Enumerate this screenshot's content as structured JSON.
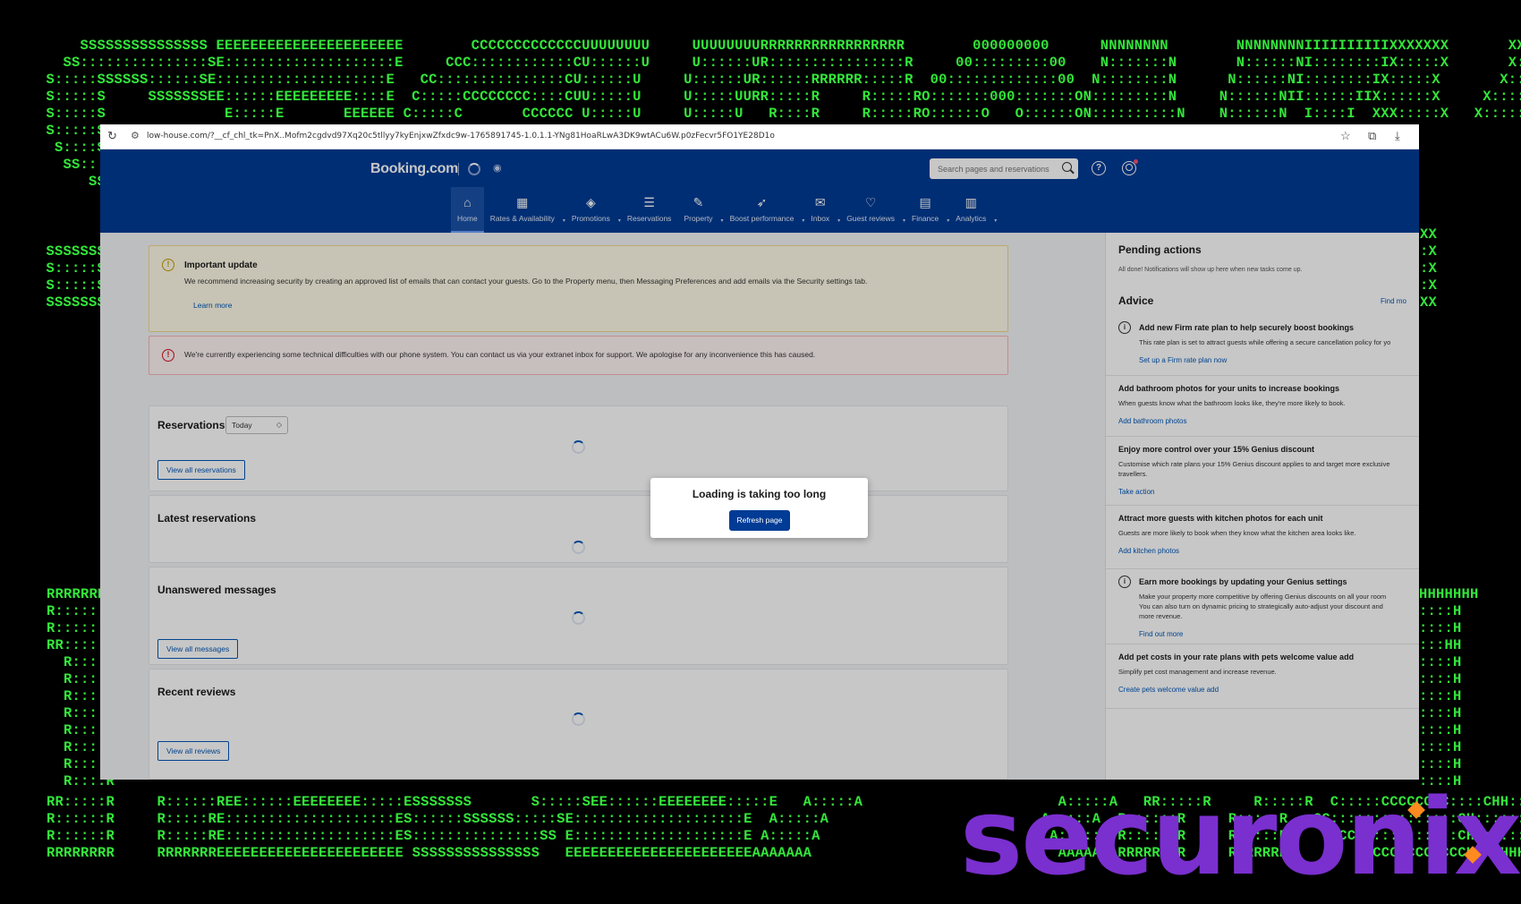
{
  "ascii_art": {
    "top_lines": [
      "     SSSSSSSSSSSSSSS EEEEEEEEEEEEEEEEEEEEEE        CCCCCCCCCCCCCUUUUUUUU     UUUUUUUURRRRRRRRRRRRRRRRR        000000000      NNNNNNNN        NNNNNNNNIIIIIIIIIIXXXXXXX       XXXXXXX",
      "   SS:::::::::::::::SE::::::::::::::::::::E     CCC::::::::::::CU::::::U     U::::::UR::::::::::::::::R     00:::::::::00    N:::::::N       N::::::NI::::::::IX:::::X       X:::::X",
      " S:::::SSSSSS::::::SE::::::::::::::::::::E   CC:::::::::::::::CU::::::U     U::::::UR::::::RRRRRR:::::R  00:::::::::::::00  N::::::::N      N::::::NI::::::::IX:::::X       X:::::X",
      " S:::::S     SSSSSSSEE::::::EEEEEEEEE::::E  C:::::CCCCCCCC::::CUU:::::U     U:::::UURR:::::R     R:::::RO:::::::000:::::::ON:::::::::N     N::::::NII::::::IIX::::::X     X::::::X",
      " S:::::S              E:::::E       EEEEEE C:::::C       CCCCCC U:::::U     U:::::U   R::::R     R:::::RO::::::O   O::::::ON::::::::::N    N::::::N  I::::I  XXX:::::X   X:::::XXX",
      " S:::::S",
      "  S::::SSSS",
      "   SS::::::SSSSS",
      "      SSS::::::::SS"
    ],
    "left_mid_lines": [
      " SSSSSSS",
      " S:::::S",
      " S:::::S",
      " SSSSSSS"
    ],
    "right_mid_lines": [
      "XX",
      ":X",
      ":X",
      ":X",
      "XX"
    ],
    "left_bottom_lines": [
      "RRRRRRRR",
      "R::::::R",
      "R::::::R",
      "RR:::::R",
      "  R::::R",
      "  R::::R",
      "  R::::R",
      "  R::::R",
      "  R::::R",
      "  R::::R",
      "  R::::R",
      "  R::::R"
    ],
    "right_bottom_lines": [
      "HHHHHHH",
      "::::H",
      "::::H",
      ":::HH",
      "::::H",
      "::::H",
      "::::H",
      "::::H",
      "::::H",
      "::::H",
      "::::H",
      "::::H"
    ],
    "bottom_lines": [
      "RR:::::R     R::::::REE::::::EEEEEEEE:::::ESSSSSSS       S:::::SEE::::::EEEEEEEE:::::E   A:::::A                       A:::::A   RR:::::R     R:::::R  C:::::CCCCCCCC::::CHH::::::H     H::::::HH",
      "R::::::R     R:::::RE::::::::::::::::::::ES::::::SSSSSS:::::SE::::::::::::::::::::E  A:::::A                         A:::::A  R::::::R     R:::::R   CC:::::::::::::::CH:::::::H     H:::::::H",
      "R::::::R     R:::::RE::::::::::::::::::::ES:::::::::::::::SS E::::::::::::::::::::E A:::::A                           A:::::A R::::::R     R:::::R     CCC::::::::::::CH:::::::H     H:::::::H",
      "RRRRRRRR     RRRRRRREEEEEEEEEEEEEEEEEEEEEE SSSSSSSSSSSSSSS   EEEEEEEEEEEEEEEEEEEEEEAAAAAAA                             AAAAAAARRRRRRRR     RRRRRRR        CCCCCCCCCCCCCHHHHHHHHH     HHHHHHHHH"
    ]
  },
  "brand": {
    "name": "securonix",
    "color": "#7a2fcf",
    "spark_color": "#ff8a1f"
  },
  "browser": {
    "url": "low-house.com/?__cf_chl_tk=PnX..Mofm2cgdvd97Xq20c5tllyy7kyEnjxwZfxdc9w-1765891745-1.0.1.1-YNg81HoaRLwA3DK9wtACu6W.p0zFecvr5FO1YE28D1o"
  },
  "header": {
    "logo": "Booking.com",
    "search_placeholder": "Search pages and reservations",
    "brand_color": "#003b95"
  },
  "nav": [
    {
      "label": "Home",
      "icon": "home-icon",
      "active": true
    },
    {
      "label": "Rates & Availability",
      "icon": "calendar-icon",
      "dropdown": true
    },
    {
      "label": "Promotions",
      "icon": "tag-icon",
      "dropdown": true
    },
    {
      "label": "Reservations",
      "icon": "list-icon"
    },
    {
      "label": "Property",
      "icon": "pen-icon",
      "dropdown": true
    },
    {
      "label": "Boost performance",
      "icon": "rocket-icon",
      "dropdown": true
    },
    {
      "label": "Inbox",
      "icon": "envelope-icon",
      "dropdown": true
    },
    {
      "label": "Guest reviews",
      "icon": "heart-icon",
      "dropdown": true
    },
    {
      "label": "Finance",
      "icon": "document-icon",
      "dropdown": true
    },
    {
      "label": "Analytics",
      "icon": "bar-chart-icon",
      "dropdown": true
    }
  ],
  "alerts": {
    "warning": {
      "title": "Important update",
      "body": "We recommend increasing security by creating an approved list of emails that can contact your guests. Go to the Property menu, then Messaging Preferences and add emails via the Security settings tab.",
      "link": "Learn more"
    },
    "error": {
      "body": "We're currently experiencing some technical difficulties with our phone system. You can contact us via your extranet inbox for support. We apologise for any inconvenience this has caused."
    }
  },
  "sections": {
    "reservations": {
      "title": "Reservations",
      "filter": "Today",
      "button": "View all reservations"
    },
    "latest": {
      "title": "Latest reservations"
    },
    "messages": {
      "title": "Unanswered messages",
      "button": "View all messages"
    },
    "reviews": {
      "title": "Recent reviews",
      "button": "View all reviews"
    }
  },
  "sidebar": {
    "pending_title": "Pending actions",
    "pending_sub": "All done! Notifications will show up here when new tasks come up.",
    "advice_title": "Advice",
    "advice_find_more": "Find mo",
    "advice": [
      {
        "title": "Add new Firm rate plan to help securely boost bookings",
        "desc": "This rate plan is set to attract guests while offering a secure cancellation policy for yo",
        "link": "Set up a Firm rate plan now",
        "icon": true
      },
      {
        "title": "Add bathroom photos for your units to increase bookings",
        "desc": "When guests know what the bathroom looks like, they're more likely to book.",
        "link": "Add bathroom photos",
        "icon": false
      },
      {
        "title": "Enjoy more control over your 15% Genius discount",
        "desc": "Customise which rate plans your 15% Genius discount applies to and target more exclusive\ntravellers.",
        "link": "Take action",
        "icon": false
      },
      {
        "title": "Attract more guests with kitchen photos for each unit",
        "desc": "Guests are more likely to book when they know what the kitchen area looks like.",
        "link": "Add kitchen photos",
        "icon": false
      },
      {
        "title": "Earn more bookings by updating your Genius settings",
        "desc": "Make your property more competitive by offering Genius discounts on all your room\nYou can also turn on dynamic pricing to strategically auto-adjust your discount and\nmore revenue.",
        "link": "Find out more",
        "icon": true
      },
      {
        "title": "Add pet costs in your rate plans with pets welcome value add",
        "desc": "Simplify pet cost management and increase revenue.",
        "link": "Create pets welcome value add",
        "icon": false
      }
    ]
  },
  "modal": {
    "title": "Loading is taking too long",
    "button": "Refresh page"
  }
}
